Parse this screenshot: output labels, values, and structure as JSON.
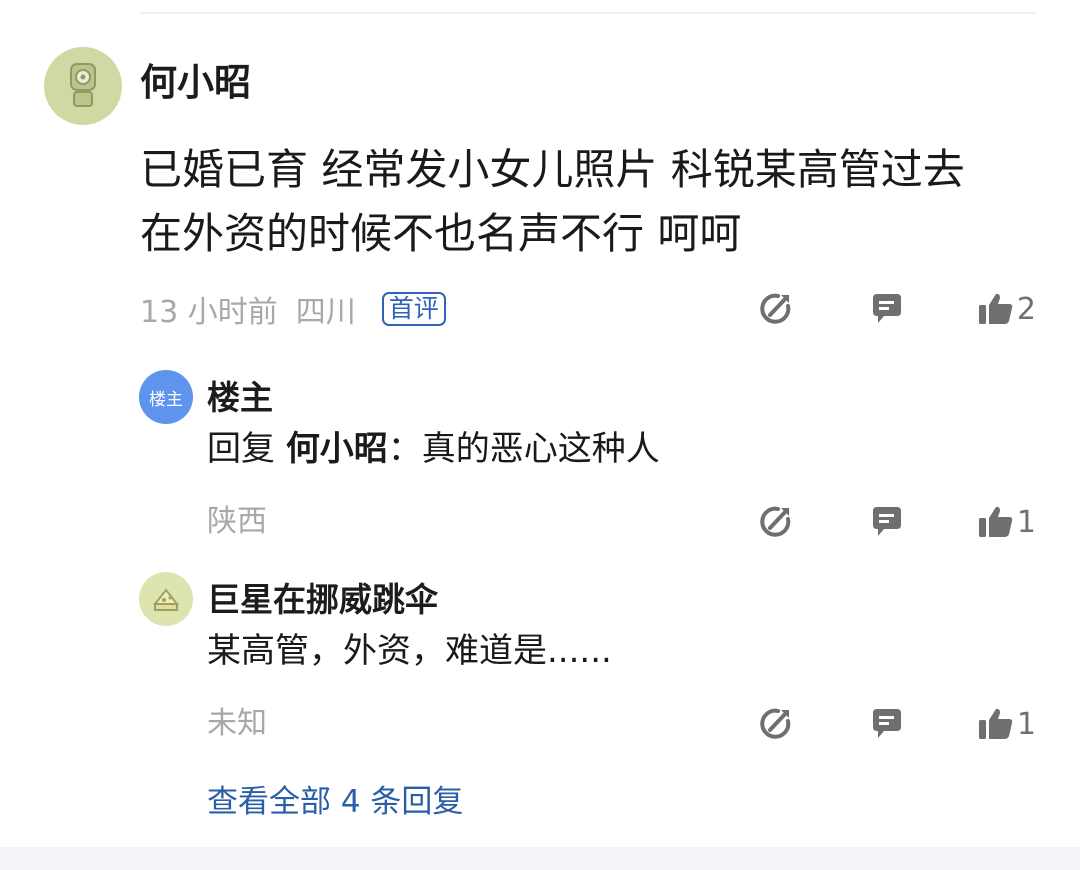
{
  "comment": {
    "username": "何小昭",
    "content_line1": "已婚已育 经常发小女儿照片 科锐某高管过去",
    "content_line2": "在外资的时候不也名声不行 呵呵",
    "time": "13 小时前",
    "location": "四川",
    "badge": "首评",
    "like_count": "2"
  },
  "replies": [
    {
      "avatar_text": "楼主",
      "username": "楼主",
      "reply_prefix": "回复 ",
      "reply_target": "何小昭",
      "text": "：真的恶心这种人",
      "location": "陕西",
      "like_count": "1"
    },
    {
      "username": "巨星在挪威跳伞",
      "text": "某高管，外资，难道是......",
      "location": "未知",
      "like_count": "1"
    }
  ],
  "view_all": "查看全部 4 条回复",
  "colors": {
    "link": "#2a5fa8",
    "badge": "#2f62b8",
    "meta": "#a8a8a8",
    "icon": "#6f6f6f",
    "owner_avatar": "#5e93ee"
  },
  "icons": {
    "share": "share-icon",
    "reply": "comment-bubble-icon",
    "like": "thumbs-up-icon"
  }
}
